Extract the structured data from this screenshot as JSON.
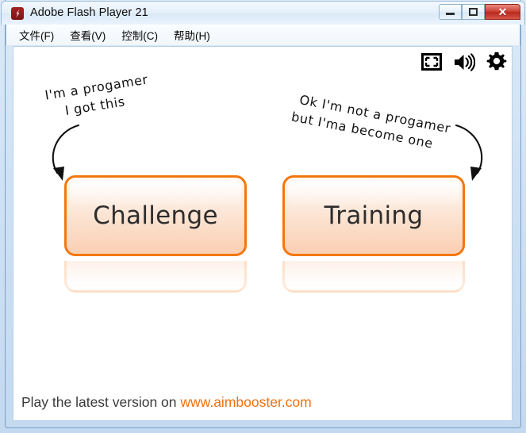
{
  "window": {
    "title": "Adobe Flash Player 21",
    "app_icon": "flash-icon",
    "controls": {
      "minimize": "–",
      "maximize": "□",
      "close": "✕"
    }
  },
  "menubar": {
    "items": [
      {
        "label": "文件(F)",
        "name": "menu-file"
      },
      {
        "label": "查看(V)",
        "name": "menu-view"
      },
      {
        "label": "控制(C)",
        "name": "menu-control"
      },
      {
        "label": "帮助(H)",
        "name": "menu-help"
      }
    ]
  },
  "flash_controls": [
    {
      "name": "fullscreen-icon",
      "label": "Fullscreen"
    },
    {
      "name": "volume-icon",
      "label": "Volume"
    },
    {
      "name": "gear-icon",
      "label": "Settings"
    }
  ],
  "stage": {
    "notes": {
      "left": {
        "line1": "I'm a progamer",
        "line2": "I got this"
      },
      "right": {
        "line1": "Ok I'm not a progamer",
        "line2": "but I'ma become one"
      }
    },
    "buttons": [
      {
        "name": "challenge-button",
        "label": "Challenge"
      },
      {
        "name": "training-button",
        "label": "Training"
      }
    ],
    "challenge_label": "Challenge",
    "training_label": "Training",
    "footer": {
      "prefix": "Play the latest version on ",
      "url": "www.aimbooster.com"
    }
  },
  "colors": {
    "button_border": "#f4770d",
    "button_fill_top": "#fefaf7",
    "button_fill_bottom": "#fbcfb3",
    "url_orange": "#f2700f",
    "titlebar_text": "#0b0b0b",
    "close_red": "#cf4438"
  }
}
